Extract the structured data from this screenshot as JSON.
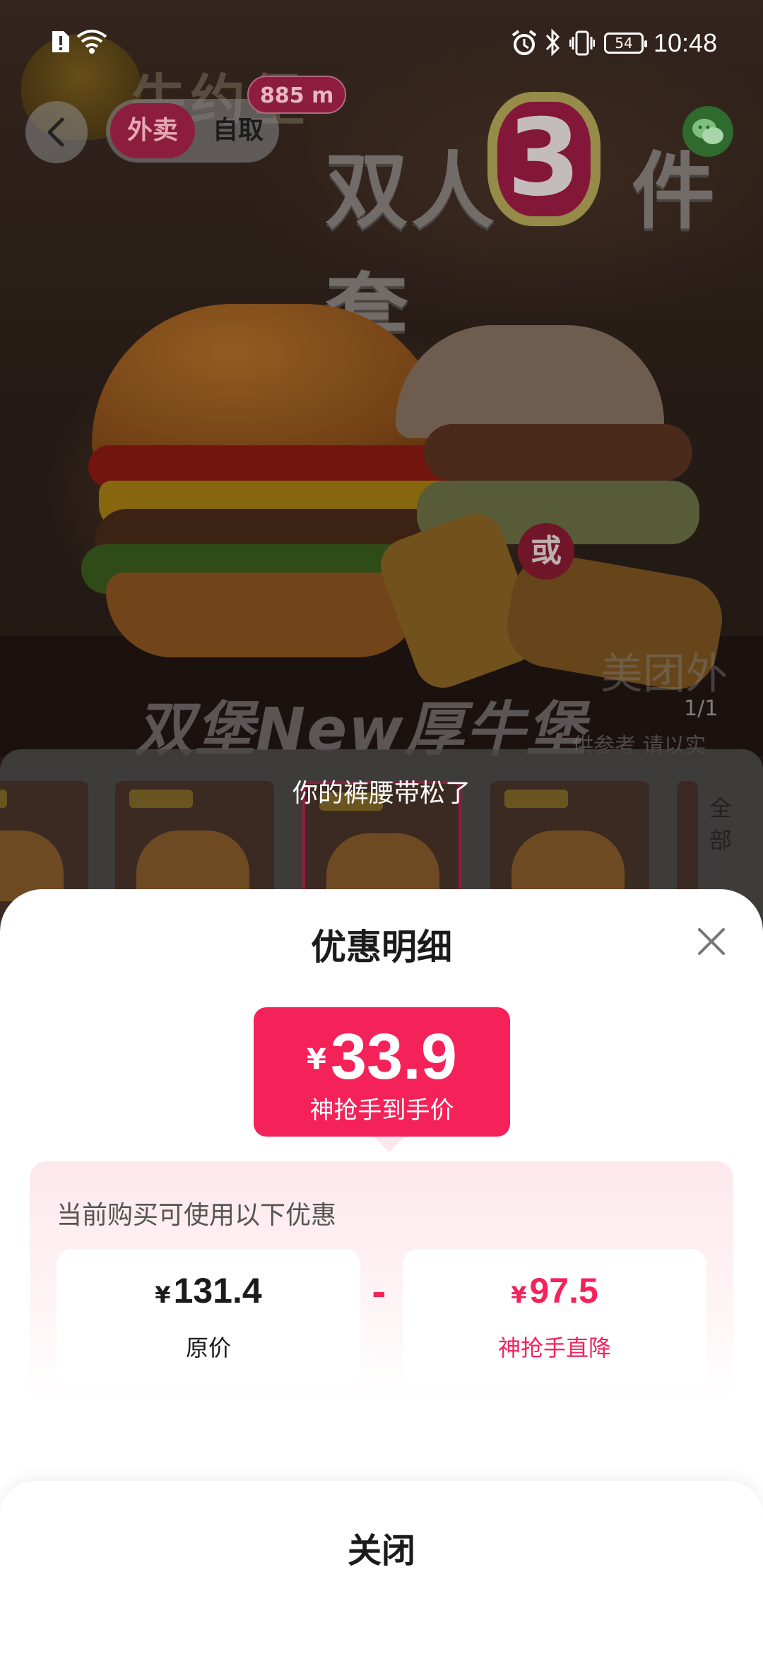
{
  "status_bar": {
    "time": "10:48",
    "battery": "54"
  },
  "header": {
    "mode_tabs": [
      {
        "label": "外卖"
      },
      {
        "label": "自取"
      }
    ],
    "distance": "885 m"
  },
  "hero": {
    "brand_name": "牛约堡",
    "promo_title_a": "双人",
    "promo_number": "3",
    "promo_title_b": "件套",
    "or_badge": "或",
    "product_caption": "双堡New厚牛堡",
    "watermark": "美团外",
    "disclaimer": "供参考 请以实",
    "image_counter": "1/1"
  },
  "thumbnails": {
    "all_label": "全部"
  },
  "toast": "你的裤腰带松了",
  "sheet": {
    "title": "优惠明细",
    "final_price": {
      "currency": "¥",
      "value": "33.9",
      "caption": "神抢手到手价"
    },
    "panel_caption": "当前购买可使用以下优惠",
    "original": {
      "currency": "¥",
      "value": "131.4",
      "label": "原价"
    },
    "operator": "-",
    "discount": {
      "currency": "¥",
      "value": "97.5",
      "label": "神抢手直降"
    },
    "close_label": "关闭"
  },
  "colors": {
    "accent": "#f5225a",
    "panel_tint": "#fde8ed"
  }
}
